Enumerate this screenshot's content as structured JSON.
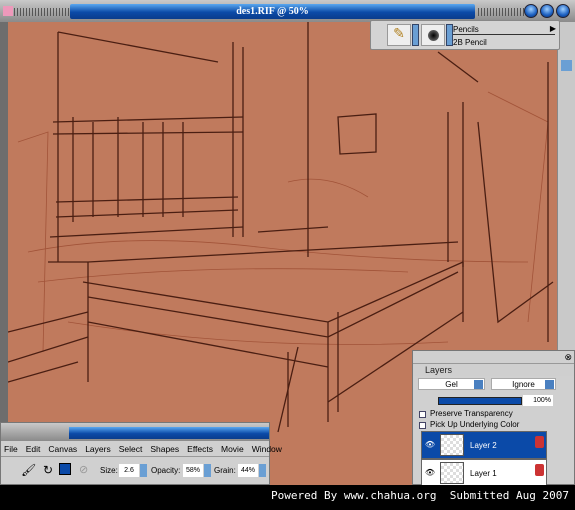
{
  "window": {
    "title": "des1.RIF @ 50%"
  },
  "brush": {
    "category": "Pencils",
    "variant": "2B Pencil"
  },
  "menu": {
    "items": [
      "File",
      "Edit",
      "Canvas",
      "Layers",
      "Select",
      "Shapes",
      "Effects",
      "Movie",
      "Window"
    ]
  },
  "property_bar": {
    "size_label": "Size:",
    "size": "2.6",
    "opacity_label": "Opacity:",
    "opacity": "58%",
    "grain_label": "Grain:",
    "grain": "44%"
  },
  "layers": {
    "title": "Layers",
    "composite_method": "Gel",
    "composite_depth": "Ignore",
    "opacity": "100%",
    "preserve_transparency": "Preserve Transparency",
    "pick_up_color": "Pick Up Underlying Color",
    "items": [
      {
        "name": "Layer 2",
        "selected": true
      },
      {
        "name": "Layer 1",
        "selected": false
      }
    ]
  },
  "footer": {
    "text": "Powered By www.chahua.org  Submitted Aug 2007"
  },
  "colors": {
    "canvas": "#c07a5d",
    "accent": "#0b4aa8"
  }
}
